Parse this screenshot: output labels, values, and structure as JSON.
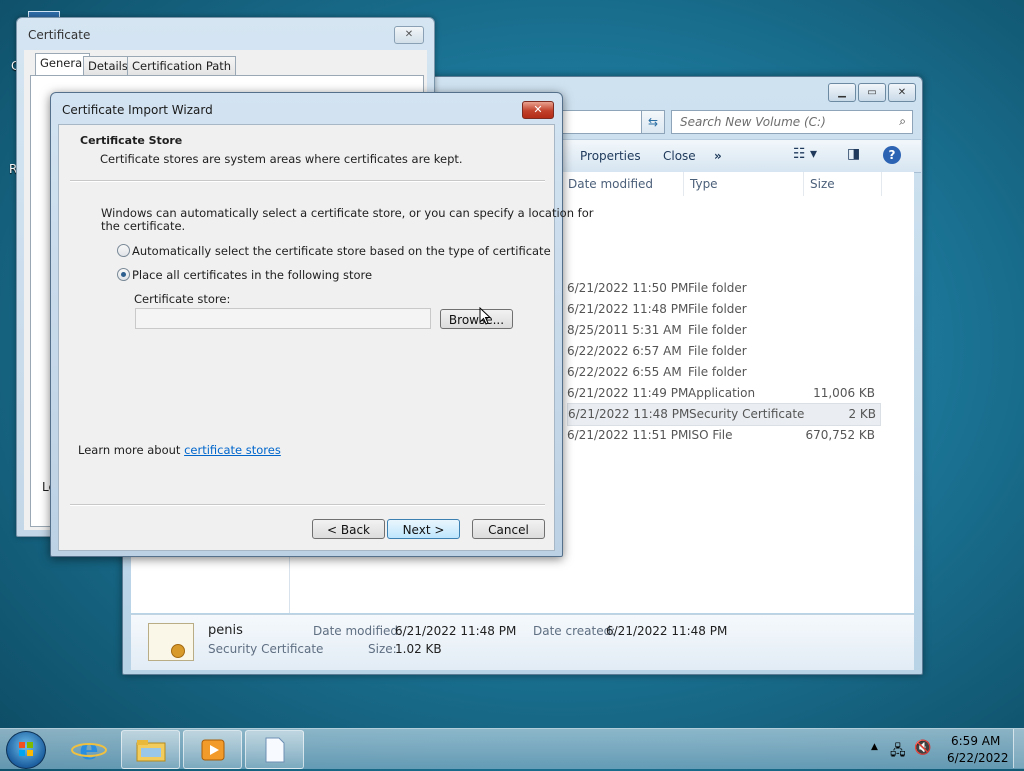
{
  "explorer": {
    "search_placeholder": "Search New Volume (C:)",
    "toolbar": {
      "properties": "Properties",
      "close": "Close",
      "more": "»"
    },
    "columns": {
      "date": "Date modified",
      "type": "Type",
      "size": "Size"
    },
    "rows": [
      {
        "date": "6/21/2022 11:50 PM",
        "type": "File folder",
        "size": ""
      },
      {
        "date": "6/21/2022 11:48 PM",
        "type": "File folder",
        "size": ""
      },
      {
        "date": "8/25/2011 5:31 AM",
        "type": "File folder",
        "size": ""
      },
      {
        "date": "6/22/2022 6:57 AM",
        "type": "File folder",
        "size": ""
      },
      {
        "date": "6/22/2022 6:55 AM",
        "type": "File folder",
        "size": ""
      },
      {
        "date": "6/21/2022 11:49 PM",
        "type": "Application",
        "size": "11,006 KB"
      },
      {
        "date": "6/21/2022 11:48 PM",
        "type": "Security Certificate",
        "size": "2 KB"
      },
      {
        "date": "6/21/2022 11:51 PM",
        "type": "ISO File",
        "size": "670,752 KB"
      }
    ],
    "details": {
      "name": "penis",
      "kind": "Security Certificate",
      "modified_label": "Date modified:",
      "modified_value": "6/21/2022 11:48 PM",
      "created_label": "Date created:",
      "created_value": "6/21/2022 11:48 PM",
      "size_label": "Size:",
      "size_value": "1.02 KB"
    }
  },
  "cert_dialog": {
    "title": "Certificate",
    "tabs": [
      "General",
      "Details",
      "Certification Path"
    ],
    "partial_text": "Le"
  },
  "wizard": {
    "title": "Certificate Import Wizard",
    "section_title": "Certificate Store",
    "section_desc": "Certificate stores are system areas where certificates are kept.",
    "intro_line1": "Windows can automatically select a certificate store, or you can specify a location for",
    "intro_line2": "the certificate.",
    "radio_auto": "Automatically select the certificate store based on the type of certificate",
    "radio_place": "Place all certificates in the following store",
    "store_label": "Certificate store:",
    "store_value": "",
    "browse": "Browse...",
    "learn_prefix": "Learn more about ",
    "learn_link": "certificate stores",
    "back": "< Back",
    "next": "Next >",
    "cancel": "Cancel"
  },
  "desktop": {
    "frag1": "C",
    "frag2": "R"
  },
  "taskbar": {
    "time": "6:59 AM",
    "date": "6/22/2022"
  }
}
